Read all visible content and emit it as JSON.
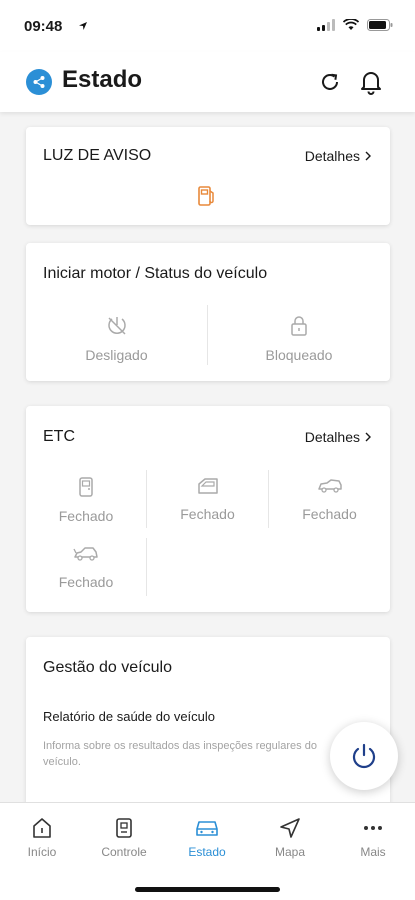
{
  "status_bar": {
    "time": "09:48",
    "icons": [
      "location-arrow-icon",
      "signal-icon",
      "wifi-icon",
      "battery-icon"
    ]
  },
  "header": {
    "title": "Estado",
    "icons": [
      "share-icon",
      "refresh-icon",
      "bell-icon"
    ],
    "accent": "#2b8fd6"
  },
  "warning_card": {
    "title": "LUZ DE AVISO",
    "link": "Detalhes",
    "icon": "fuel-pump-icon",
    "icon_color": "#e8893a"
  },
  "engine_card": {
    "title": "Iniciar motor / Status do veículo",
    "items": [
      {
        "icon": "engine-off-icon",
        "label": "Desligado"
      },
      {
        "icon": "lock-icon",
        "label": "Bloqueado"
      }
    ]
  },
  "etc_card": {
    "title": "ETC",
    "link": "Detalhes",
    "items": [
      {
        "icon": "door-icon",
        "label": "Fechado"
      },
      {
        "icon": "window-icon",
        "label": "Fechado"
      },
      {
        "icon": "trunk-icon",
        "label": "Fechado"
      },
      {
        "icon": "hood-icon",
        "label": "Fechado"
      }
    ]
  },
  "management_card": {
    "title": "Gestão do veículo",
    "subtitle": "Relatório de saúde do veículo",
    "description": "Informa sobre os resultados das inspeções regulares do veículo."
  },
  "power_button": {
    "icon": "power-icon",
    "color": "#1f3f8a"
  },
  "tabs": [
    {
      "label": "Início",
      "icon": "home-icon",
      "active": false
    },
    {
      "label": "Controle",
      "icon": "remote-control-icon",
      "active": false
    },
    {
      "label": "Estado",
      "icon": "car-icon",
      "active": true
    },
    {
      "label": "Mapa",
      "icon": "navigation-icon",
      "active": false
    },
    {
      "label": "Mais",
      "icon": "more-icon",
      "active": false
    }
  ]
}
